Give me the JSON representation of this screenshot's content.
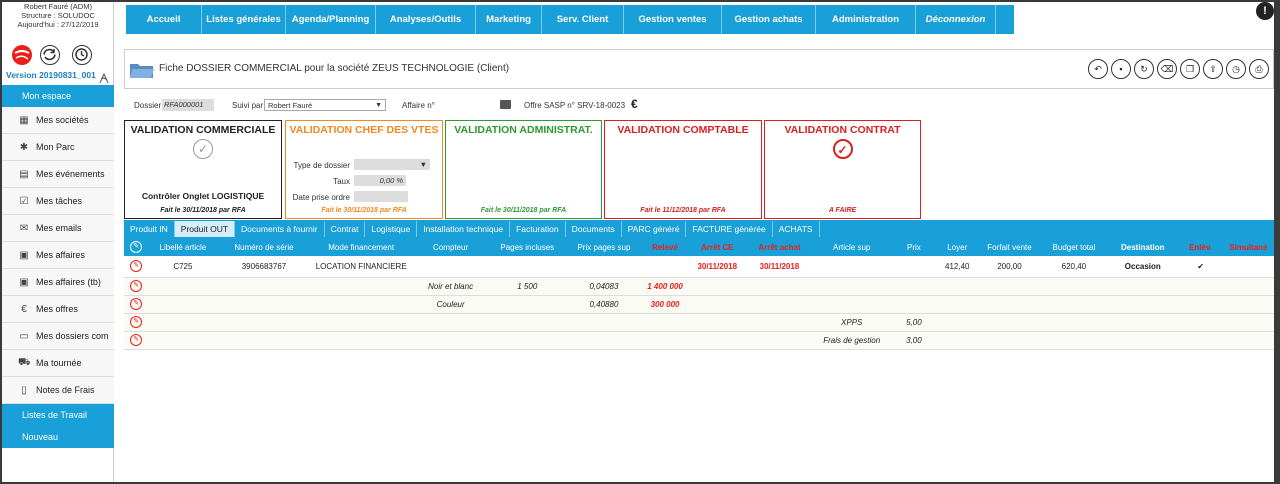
{
  "user": {
    "line1": "Robert Fauré (ADM)",
    "line2": "Structure : SOLUDOC",
    "line3": "Aujourd'hui : 27/12/2019"
  },
  "version": "Version 20190831_001",
  "left_menu": {
    "header": "Mon espace",
    "items": [
      {
        "icon": "building-icon",
        "glyph": "▦",
        "label": "Mes sociétés"
      },
      {
        "icon": "puzzle-icon",
        "glyph": "✱",
        "label": "Mon Parc"
      },
      {
        "icon": "calendar-icon",
        "glyph": "▤",
        "label": "Mes événements"
      },
      {
        "icon": "checkbox-icon",
        "glyph": "☑",
        "label": "Mes tâches"
      },
      {
        "icon": "envelope-icon",
        "glyph": "✉",
        "label": "Mes emails"
      },
      {
        "icon": "briefcase-icon",
        "glyph": "▣",
        "label": "Mes affaires"
      },
      {
        "icon": "briefcase-icon",
        "glyph": "▣",
        "label": "Mes affaires (tb)"
      },
      {
        "icon": "euro-icon",
        "glyph": "€",
        "label": "Mes offres"
      },
      {
        "icon": "folder-icon",
        "glyph": "▭",
        "label": "Mes dossiers com"
      },
      {
        "icon": "car-icon",
        "glyph": "⛟",
        "label": "Ma tournée"
      },
      {
        "icon": "document-icon",
        "glyph": "▯",
        "label": "Notes de Frais"
      }
    ],
    "footer": [
      "Listes de Travail",
      "Nouveau"
    ]
  },
  "top_nav": [
    "Accueil",
    "Listes générales",
    "Agenda/Planning",
    "Analyses/Outils",
    "Marketing",
    "Serv. Client",
    "Gestion ventes",
    "Gestion achats",
    "Administration",
    "Déconnexion"
  ],
  "alert_glyph": "!",
  "title": "Fiche DOSSIER COMMERCIAL pour la société ZEUS TECHNOLOGIE (Client)",
  "toolbar": [
    "back-icon",
    "save-icon",
    "refresh-icon",
    "delete-icon",
    "copy-icon",
    "export-icon",
    "history-icon",
    "print-icon"
  ],
  "info": {
    "dossier_label": "Dossier",
    "dossier_value": "RFA000001",
    "suivi_label": "Suivi par",
    "suivi_value": "Robert Fauré",
    "affaire_label": "Affaire n°",
    "offre_label": "Offre SASP n° SRV-18-0023",
    "euro": "€"
  },
  "validations": {
    "commerciale": {
      "title": "VALIDATION COMMERCIALE",
      "control": "Contrôler Onglet LOGISTIQUE",
      "fait": "Fait le 30/11/2018 par RFA",
      "color": "#222222"
    },
    "chef": {
      "title": "VALIDATION CHEF DES VTES",
      "type_label": "Type de dossier",
      "taux_label": "Taux",
      "taux_value": "0,00 %",
      "date_label": "Date prise ordre",
      "fait": "Fait le 30/11/2018 par RFA",
      "color": "#f0891f"
    },
    "admin": {
      "title": "VALIDATION ADMINISTRAT.",
      "fait": "Fait le 30/11/2018 par RFA",
      "color": "#2e9a2e"
    },
    "comptable": {
      "title": "VALIDATION COMPTABLE",
      "fait": "Fait le 11/12/2018 par RFA",
      "color": "#d82020"
    },
    "contrat": {
      "title": "VALIDATION CONTRAT",
      "status": "A FAIRE",
      "color": "#d82020"
    }
  },
  "tabs": [
    "Produit IN",
    "Produit OUT",
    "Documents à fournir",
    "Contrat",
    "Logistique",
    "Installation technique",
    "Facturation",
    "Documents",
    "PARC généré",
    "FACTURE générée",
    "ACHATS"
  ],
  "active_tab": "Produit OUT",
  "table": {
    "headers": [
      "",
      "Libellé article",
      "Numéro de série",
      "Mode financement",
      "Compteur",
      "Pages incluses",
      "Prix pages sup",
      "Relevé",
      "Arrêt CE",
      "Arrêt achat",
      "Article sup",
      "Prix",
      "Loyer",
      "Forfait vente",
      "Budget total",
      "Destination",
      "Enlèv.",
      "Simultané"
    ],
    "rows": [
      [
        "",
        "C725",
        "3906683767",
        "LOCATION FINANCIERE",
        "",
        "",
        "",
        "",
        "30/11/2018",
        "30/11/2018",
        "",
        "",
        "412,40",
        "200,00",
        "620,40",
        "Occasion",
        "✔",
        ""
      ],
      [
        "",
        "",
        "",
        "",
        "Noir et blanc",
        "1 500",
        "0,04083",
        "1 400 000",
        "",
        "",
        "",
        "",
        "",
        "",
        "",
        "",
        "",
        ""
      ],
      [
        "",
        "",
        "",
        "",
        "Couleur",
        "",
        "0,40880",
        "300 000",
        "",
        "",
        "",
        "",
        "",
        "",
        "",
        "",
        "",
        ""
      ],
      [
        "",
        "",
        "",
        "",
        "",
        "",
        "",
        "",
        "",
        "",
        "XPPS",
        "5,00",
        "",
        "",
        "",
        "",
        "",
        ""
      ],
      [
        "",
        "",
        "",
        "",
        "",
        "",
        "",
        "",
        "",
        "",
        "Frais de gestion",
        "3,00",
        "",
        "",
        "",
        "",
        "",
        ""
      ]
    ]
  }
}
